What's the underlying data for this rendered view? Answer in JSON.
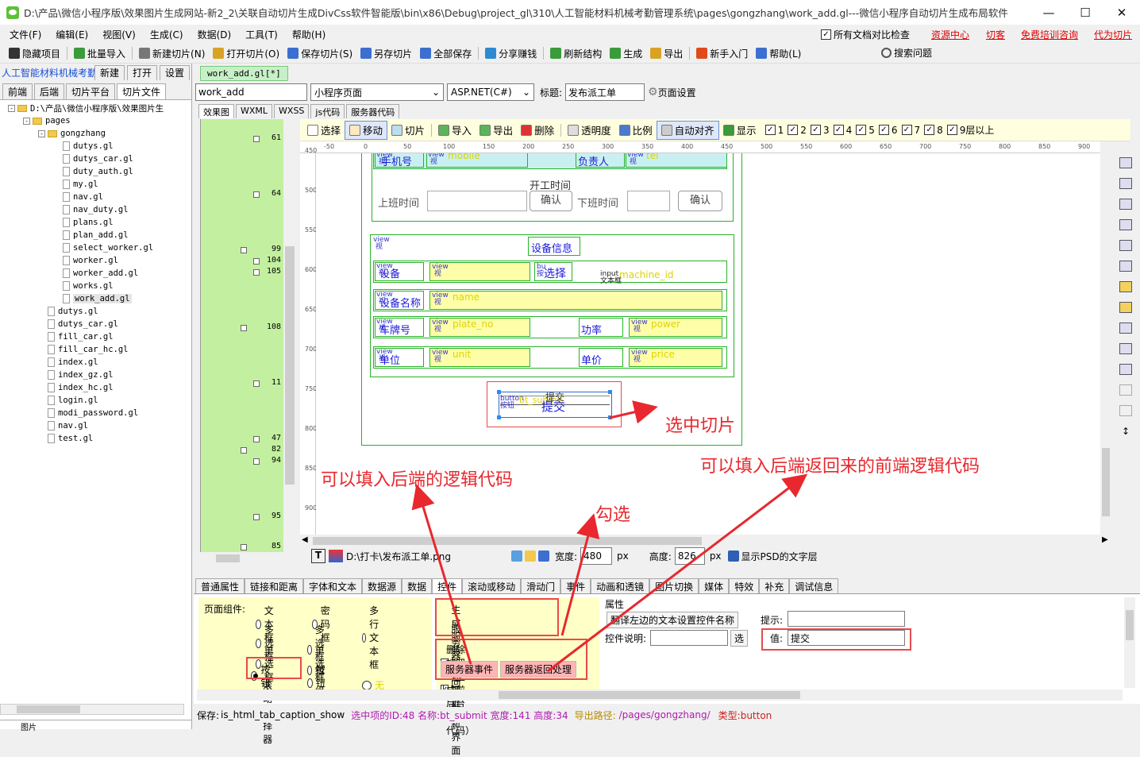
{
  "window": {
    "title": "D:\\产品\\微信小程序版\\效果图片生成网站-新2_2\\关联自动切片生成DivCss软件智能版\\bin\\x86\\Debug\\project_gl\\310\\人工智能材料机械考勤管理系统\\pages\\gongzhang\\work_add.gl---微信小程序自动切片生成布局软件",
    "minimize": "—",
    "maximize": "☐",
    "close": "✕"
  },
  "menu": {
    "items": [
      "文件(F)",
      "编辑(E)",
      "视图(V)",
      "生成(C)",
      "数据(D)",
      "工具(T)",
      "帮助(H)"
    ],
    "compare_checkbox": "所有文档对比检查",
    "links": [
      "资源中心",
      "切客",
      "免费培训咨询",
      "代为切片"
    ]
  },
  "toolbar": {
    "buttons": [
      "隐藏项目",
      "批量导入",
      "新建切片(N)",
      "打开切片(O)",
      "保存切片(S)",
      "另存切片",
      "全部保存",
      "分享赚钱",
      "刷新结构",
      "生成",
      "导出",
      "新手入门",
      "帮助(L)"
    ],
    "search": "搜索问题"
  },
  "left": {
    "project_title": "人工智能材料机械考勤",
    "project_buttons": [
      "新建",
      "打开",
      "设置"
    ],
    "tabs": [
      "前端",
      "后端",
      "切片平台",
      "切片文件"
    ],
    "active_tab": "切片文件",
    "tree": [
      {
        "depth": 0,
        "type": "folder",
        "fold": "-",
        "label": "D:\\产品\\微信小程序版\\效果图片生"
      },
      {
        "depth": 1,
        "type": "folder",
        "fold": "-",
        "label": "pages"
      },
      {
        "depth": 2,
        "type": "folder",
        "fold": "-",
        "label": "gongzhang"
      },
      {
        "depth": 3,
        "type": "file",
        "label": "dutys.gl"
      },
      {
        "depth": 3,
        "type": "file",
        "label": "dutys_car.gl"
      },
      {
        "depth": 3,
        "type": "file",
        "label": "duty_auth.gl"
      },
      {
        "depth": 3,
        "type": "file",
        "label": "my.gl"
      },
      {
        "depth": 3,
        "type": "file",
        "label": "nav.gl"
      },
      {
        "depth": 3,
        "type": "file",
        "label": "nav_duty.gl"
      },
      {
        "depth": 3,
        "type": "file",
        "label": "plans.gl"
      },
      {
        "depth": 3,
        "type": "file",
        "label": "plan_add.gl"
      },
      {
        "depth": 3,
        "type": "file",
        "label": "select_worker.gl"
      },
      {
        "depth": 3,
        "type": "file",
        "label": "worker.gl"
      },
      {
        "depth": 3,
        "type": "file",
        "label": "worker_add.gl"
      },
      {
        "depth": 3,
        "type": "file",
        "label": "works.gl"
      },
      {
        "depth": 3,
        "type": "file",
        "label": "work_add.gl",
        "selected": true
      },
      {
        "depth": 2,
        "type": "file",
        "label": "dutys.gl"
      },
      {
        "depth": 2,
        "type": "file",
        "label": "dutys_car.gl"
      },
      {
        "depth": 2,
        "type": "file",
        "label": "fill_car.gl"
      },
      {
        "depth": 2,
        "type": "file",
        "label": "fill_car_hc.gl"
      },
      {
        "depth": 2,
        "type": "file",
        "label": "index.gl"
      },
      {
        "depth": 2,
        "type": "file",
        "label": "index_gz.gl"
      },
      {
        "depth": 2,
        "type": "file",
        "label": "index_hc.gl"
      },
      {
        "depth": 2,
        "type": "file",
        "label": "login.gl"
      },
      {
        "depth": 2,
        "type": "file",
        "label": "modi_password.gl"
      },
      {
        "depth": 2,
        "type": "file",
        "label": "nav.gl"
      },
      {
        "depth": 2,
        "type": "file",
        "label": "test.gl"
      }
    ],
    "bottom_label": "图片"
  },
  "editor": {
    "file_tab": "work_add.gl[*]",
    "page_name": "work_add",
    "page_type": "小程序页面",
    "lang": "ASP.NET(C#)",
    "title_label": "标题:",
    "title_value": "发布派工单",
    "page_settings": "页面设置",
    "code_tabs": [
      "效果图",
      "WXML",
      "WXSS",
      "js代码",
      "服务器代码"
    ],
    "gutter_numbers": [
      "61",
      "64",
      "99",
      "104",
      "105",
      "108",
      "11",
      "47",
      "82",
      "94",
      "95",
      "85"
    ],
    "tools": [
      "选择",
      "移动",
      "切片",
      "导入",
      "导出",
      "删除",
      "透明度",
      "比例",
      "自动对齐",
      "显示"
    ],
    "layers": [
      "1",
      "2",
      "3",
      "4",
      "5",
      "6",
      "7",
      "8",
      "9层以上"
    ],
    "ruler_top": [
      "-50",
      "0",
      "50",
      "100",
      "150",
      "200",
      "250",
      "300",
      "350",
      "400",
      "450",
      "500",
      "550",
      "600",
      "650",
      "700",
      "750",
      "800",
      "850",
      "900"
    ],
    "ruler_left": [
      "450",
      "500",
      "550",
      "600",
      "650",
      "700",
      "750",
      "800",
      "850",
      "900"
    ]
  },
  "design": {
    "row1_labels": [
      "手机号",
      "mobile",
      "负责人",
      "tel"
    ],
    "worktime_title": "开工时间",
    "start_label": "上班时间",
    "end_label": "下班时间",
    "confirm": "确认",
    "device_title": "设备信息",
    "device_label": "设备",
    "select_btn": "选择",
    "machine_id": "machine_id",
    "input_hint": "input\n文本框",
    "device_name": "设备名称",
    "name_field": "name",
    "plate": "车牌号",
    "plate_field": "plate_no",
    "power": "功率",
    "power_field": "power",
    "unit": "单位",
    "unit_field": "unit",
    "unit_price": "单价",
    "price_field": "price",
    "submit_text": "提交",
    "submit_id": "bt_submit",
    "button_label": "button\n按钮",
    "view_tag": "view\n视"
  },
  "bottom_tools": {
    "path": "D:\\打卡\\发布派工单.png",
    "width_label": "宽度:",
    "width_value": "480",
    "height_label": "高度:",
    "height_value": "826",
    "unit": "px",
    "psd_text": "显示PSD的文字层"
  },
  "props": {
    "tabs": [
      "普通属性",
      "链接和距离",
      "字体和文本",
      "数据源",
      "数据",
      "控件",
      "滚动或移动",
      "滑动门",
      "事件",
      "动画和透镜",
      "图片切换",
      "媒体",
      "特效",
      "补充",
      "调试信息"
    ],
    "active_tab": "控件",
    "page_components": "页面组件:",
    "radios": [
      "文本框",
      "密码框",
      "多行文本框",
      "多选框",
      "多选框组",
      "单选框",
      "单选框组",
      "按钮",
      "按钮组",
      "滚动选择器",
      "无"
    ],
    "selected_radio": "按钮",
    "checks": [
      "生成服务器处理框架",
      "服务器返回时刷新界面",
      "删除按钮（生成前后台删除代码）"
    ],
    "checked": [
      true,
      true,
      false
    ],
    "server_event": "服务器事件",
    "server_return": "服务器返回处理",
    "attr_title": "属性",
    "translate_btn": "翻译左边的文本设置控件名称",
    "control_desc": "控件说明:",
    "select_btn": "选",
    "hint_label": "提示:",
    "value_label": "值:",
    "value": "提交"
  },
  "status": {
    "save_label": "保存:",
    "save_value": "is_html_tab_caption_show",
    "selected_info": "选中项的ID:48 名称:bt_submit 宽度:141 高度:34",
    "export_label": "导出路径:",
    "export_path": "/pages/gongzhang/",
    "type": "类型:button"
  },
  "annotations": {
    "selected_slice": "选中切片",
    "backend_logic": "可以填入后端的逻辑代码",
    "check": "勾选",
    "frontend_logic": "可以填入后端返回来的前端逻辑代码"
  },
  "colors": {
    "annotation_red": "#e8282e",
    "gutter_green": "#c3f0a0",
    "slice_green": "#26b326",
    "slice_yellow": "#fffea8",
    "text_blue": "#1a1adb",
    "link_red": "#dd0000"
  }
}
